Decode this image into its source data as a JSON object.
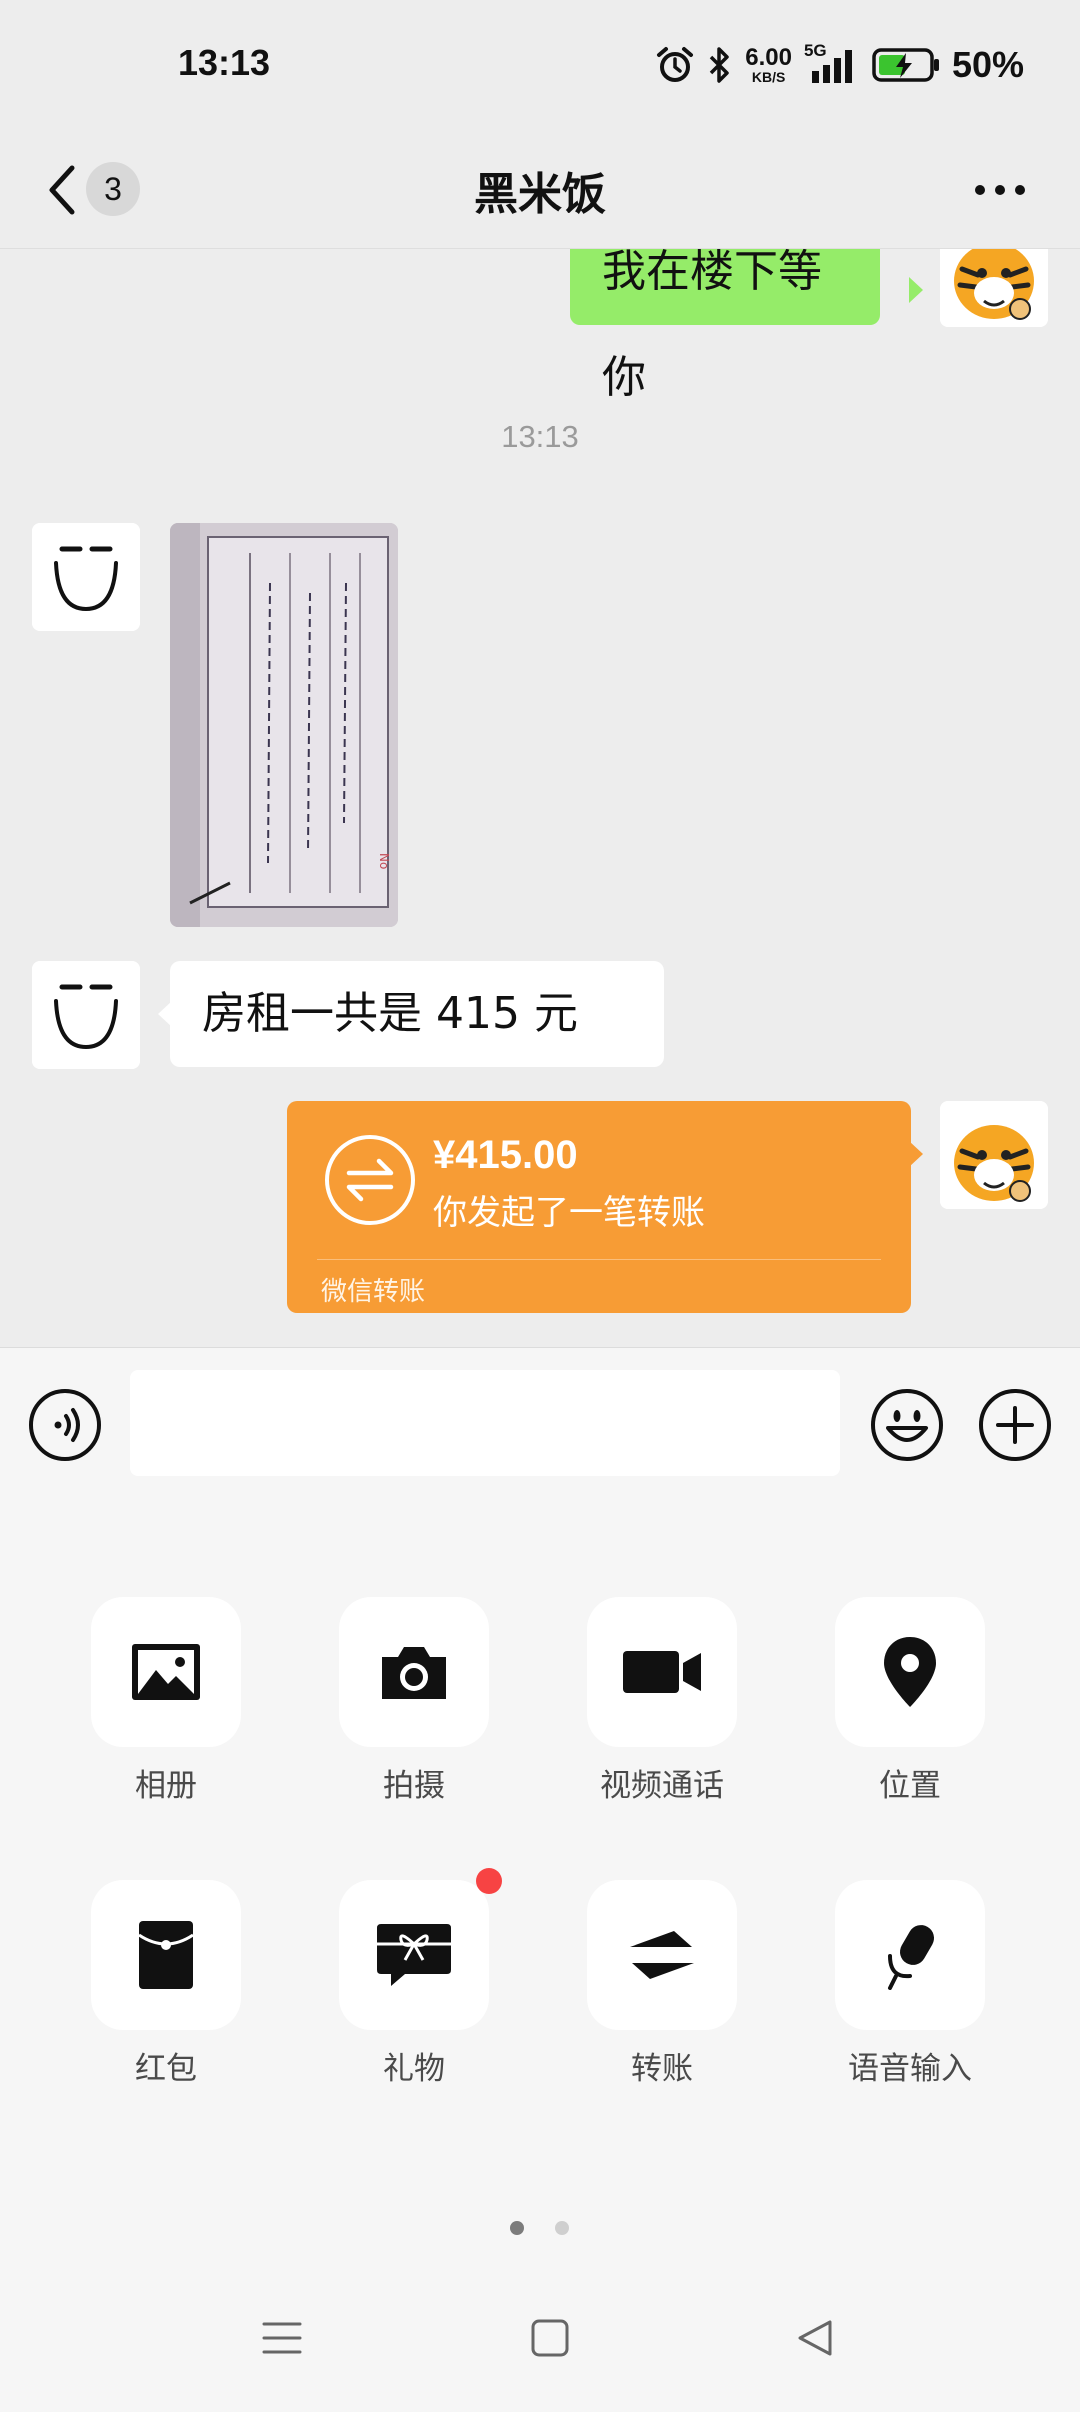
{
  "status_bar": {
    "time": "13:13",
    "net_speed_value": "6.00",
    "net_speed_unit": "KB/S",
    "network": "5G",
    "battery": "50%",
    "icons": [
      "alarm-icon",
      "bluetooth-icon",
      "signal-icon",
      "battery-charging-icon"
    ]
  },
  "header": {
    "back_icon": "chevron-left-icon",
    "unread_count": "3",
    "title": "黑米饭",
    "more_icon": "more-dots-icon"
  },
  "chat": {
    "outgoing_text_1": "我在楼下等你",
    "timestamp": "13:13",
    "incoming_image_icon": "receipt-photo",
    "incoming_text": "房租一共是 415 元",
    "transfer": {
      "amount": "¥415.00",
      "description": "你发起了一笔转账",
      "footer": "微信转账",
      "icon": "transfer-arrows-icon"
    }
  },
  "input_bar": {
    "voice_icon": "voice-icon",
    "text_value": "",
    "emoji_icon": "emoji-icon",
    "plus_icon": "plus-icon"
  },
  "panel": {
    "items": [
      {
        "label": "相册",
        "icon": "photo-album-icon"
      },
      {
        "label": "拍摄",
        "icon": "camera-icon"
      },
      {
        "label": "视频通话",
        "icon": "video-call-icon"
      },
      {
        "label": "位置",
        "icon": "location-icon"
      },
      {
        "label": "红包",
        "icon": "red-packet-icon"
      },
      {
        "label": "礼物",
        "icon": "gift-icon"
      },
      {
        "label": "转账",
        "icon": "transfer-icon"
      },
      {
        "label": "语音输入",
        "icon": "microphone-icon"
      }
    ],
    "page_count": 2,
    "current_page": 1
  },
  "colors": {
    "outgoing_bubble": "#95ec69",
    "transfer_card": "#f79c35",
    "background": "#ededed",
    "panel": "#f6f6f6",
    "badge_red": "#f74343"
  },
  "system_nav": [
    "menu-icon",
    "home-icon",
    "back-triangle-icon"
  ]
}
